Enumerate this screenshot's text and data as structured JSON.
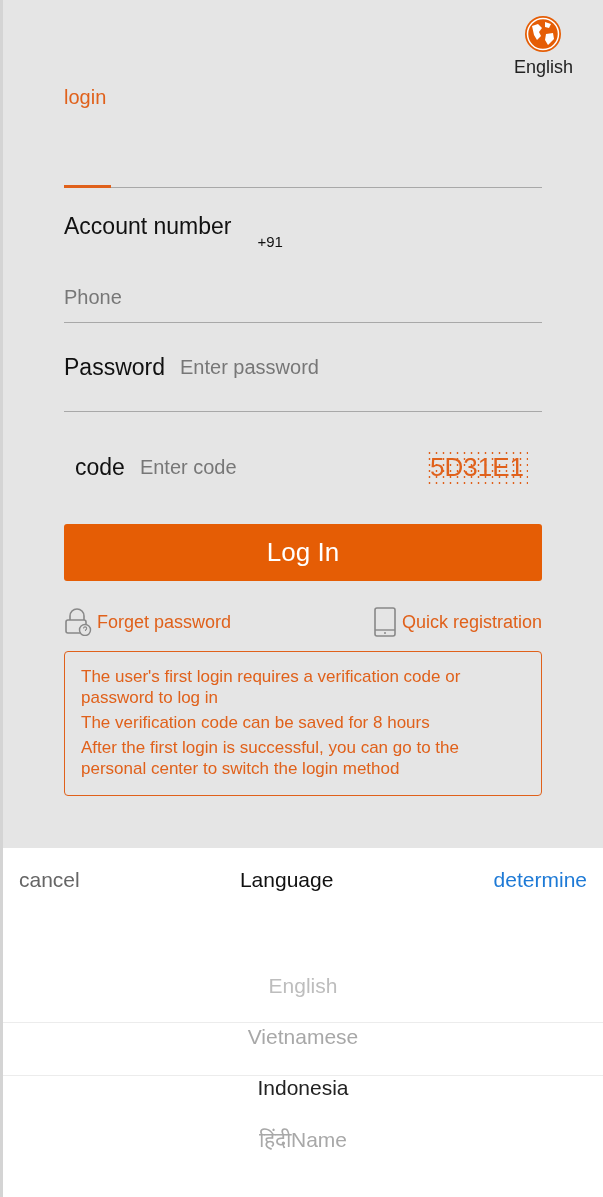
{
  "language_switch": {
    "label": "English"
  },
  "tabs": [
    {
      "label": "login",
      "selected": true
    }
  ],
  "account": {
    "label": "Account number",
    "country_code": "+91",
    "placeholder": "Phone"
  },
  "password": {
    "label": "Password",
    "placeholder": "Enter password"
  },
  "code": {
    "label": "code",
    "placeholder": "Enter code",
    "captcha": "5D31E1"
  },
  "login_button": "Log In",
  "links": [
    {
      "kind": "lock",
      "label": "Forget password"
    },
    {
      "kind": "phone",
      "label": "Quick registration"
    }
  ],
  "notice": [
    "The user's first login requires a verification code or password to log in",
    "The verification code can be saved for 8 hours",
    "After the first login is successful, you can go to the personal center to switch the login method"
  ],
  "picker": {
    "cancel": "cancel",
    "title": "Language",
    "confirm": "determine",
    "options": [
      {
        "label": "English",
        "selected": false
      },
      {
        "label": "Vietnamese",
        "selected": false
      },
      {
        "label": "Indonesia",
        "selected": true
      },
      {
        "label": "हिंदीName",
        "selected": false
      }
    ]
  }
}
